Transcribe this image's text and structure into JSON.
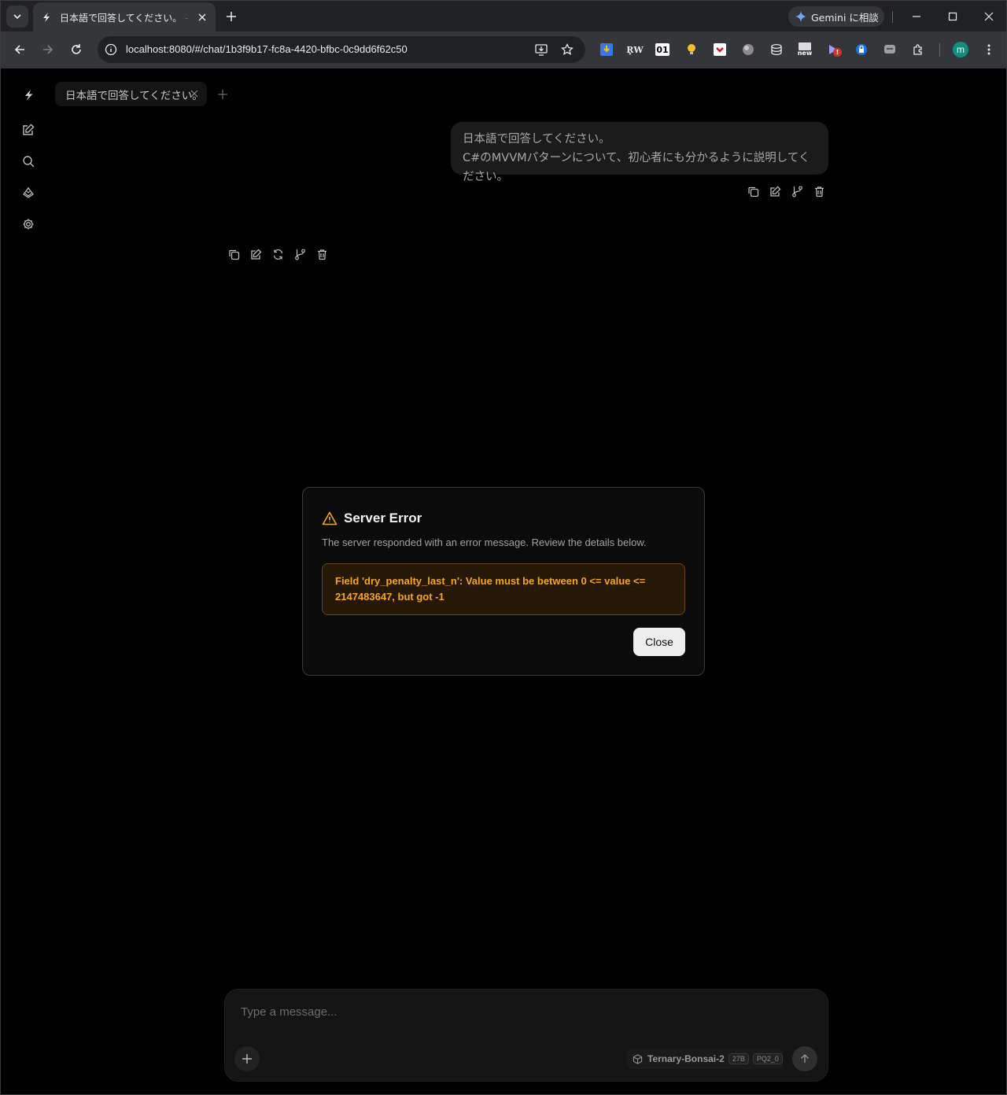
{
  "browser": {
    "tab_title": "日本語で回答してください。 - llama.cpp",
    "url": "localhost:8080/#/chat/1b3f9b17-fc8a-4420-bfbc-0c9dd6f62c50",
    "gemini_label": "Gemini に相談",
    "profile_initial": "m",
    "extensions": [
      "download-ext-icon",
      "rw-ext-icon",
      "01-ext-icon",
      "bulb-ext-icon",
      "pocket-ext-icon",
      "circle-ext-icon",
      "stack-ext-icon",
      "new-ext-icon",
      "bookmark-ext-icon",
      "lock-ext-icon",
      "chat-ext-icon",
      "puzzle-ext-icon"
    ],
    "ext_labels": {
      "rw": "R̥W",
      "zero_one": "01",
      "new": "new",
      "badge": "!"
    }
  },
  "chat": {
    "tab_label": "日本語で回答してください。",
    "user_message_line1": "日本語で回答してください。",
    "user_message_line2": "C#のMVVMパターンについて、初心者にも分かるように説明してください。"
  },
  "error_dialog": {
    "title": "Server Error",
    "description": "The server responded with an error message. Review the details below.",
    "error_message": "Field 'dry_penalty_last_n': Value must be between 0 <= value <= 2147483647, but got -1",
    "close_label": "Close"
  },
  "composer": {
    "placeholder": "Type a message...",
    "model_name": "Ternary-Bonsai-2",
    "model_size": "27B",
    "model_quant": "PQ2_0"
  },
  "colors": {
    "accent_warning": "#f5a623",
    "background": "#000000"
  }
}
